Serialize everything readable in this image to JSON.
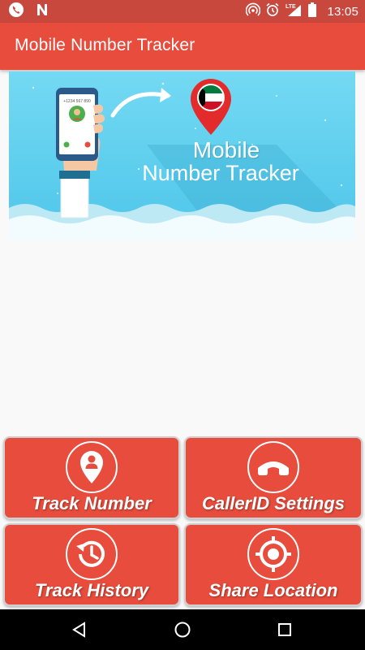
{
  "status_bar": {
    "time": "13:05",
    "left_icons": [
      "phone-call-icon",
      "n-notification-icon"
    ],
    "right_icons": [
      "hotspot-icon",
      "alarm-icon",
      "lte-signal-icon",
      "battery-icon"
    ],
    "network_label": "LTE"
  },
  "toolbar": {
    "title": "Mobile Number Tracker"
  },
  "banner": {
    "line1": "Mobile",
    "line2": "Number Tracker",
    "phone_screen_text": "+1234 567 890"
  },
  "buttons": [
    {
      "label": "Track Number",
      "icon": "location-person-icon"
    },
    {
      "label": "CallerID Settings",
      "icon": "phone-handset-icon"
    },
    {
      "label": "Track History",
      "icon": "history-icon"
    },
    {
      "label": "Share Location",
      "icon": "crosshair-icon"
    }
  ],
  "nav_bar": {
    "items": [
      "back-icon",
      "home-icon",
      "recents-icon"
    ]
  },
  "colors": {
    "status_bar": "#c9483e",
    "toolbar": "#e74c3c",
    "button": "#e74c3c",
    "background": "#f9f9f9",
    "banner_sky": "#5fd0ef"
  }
}
